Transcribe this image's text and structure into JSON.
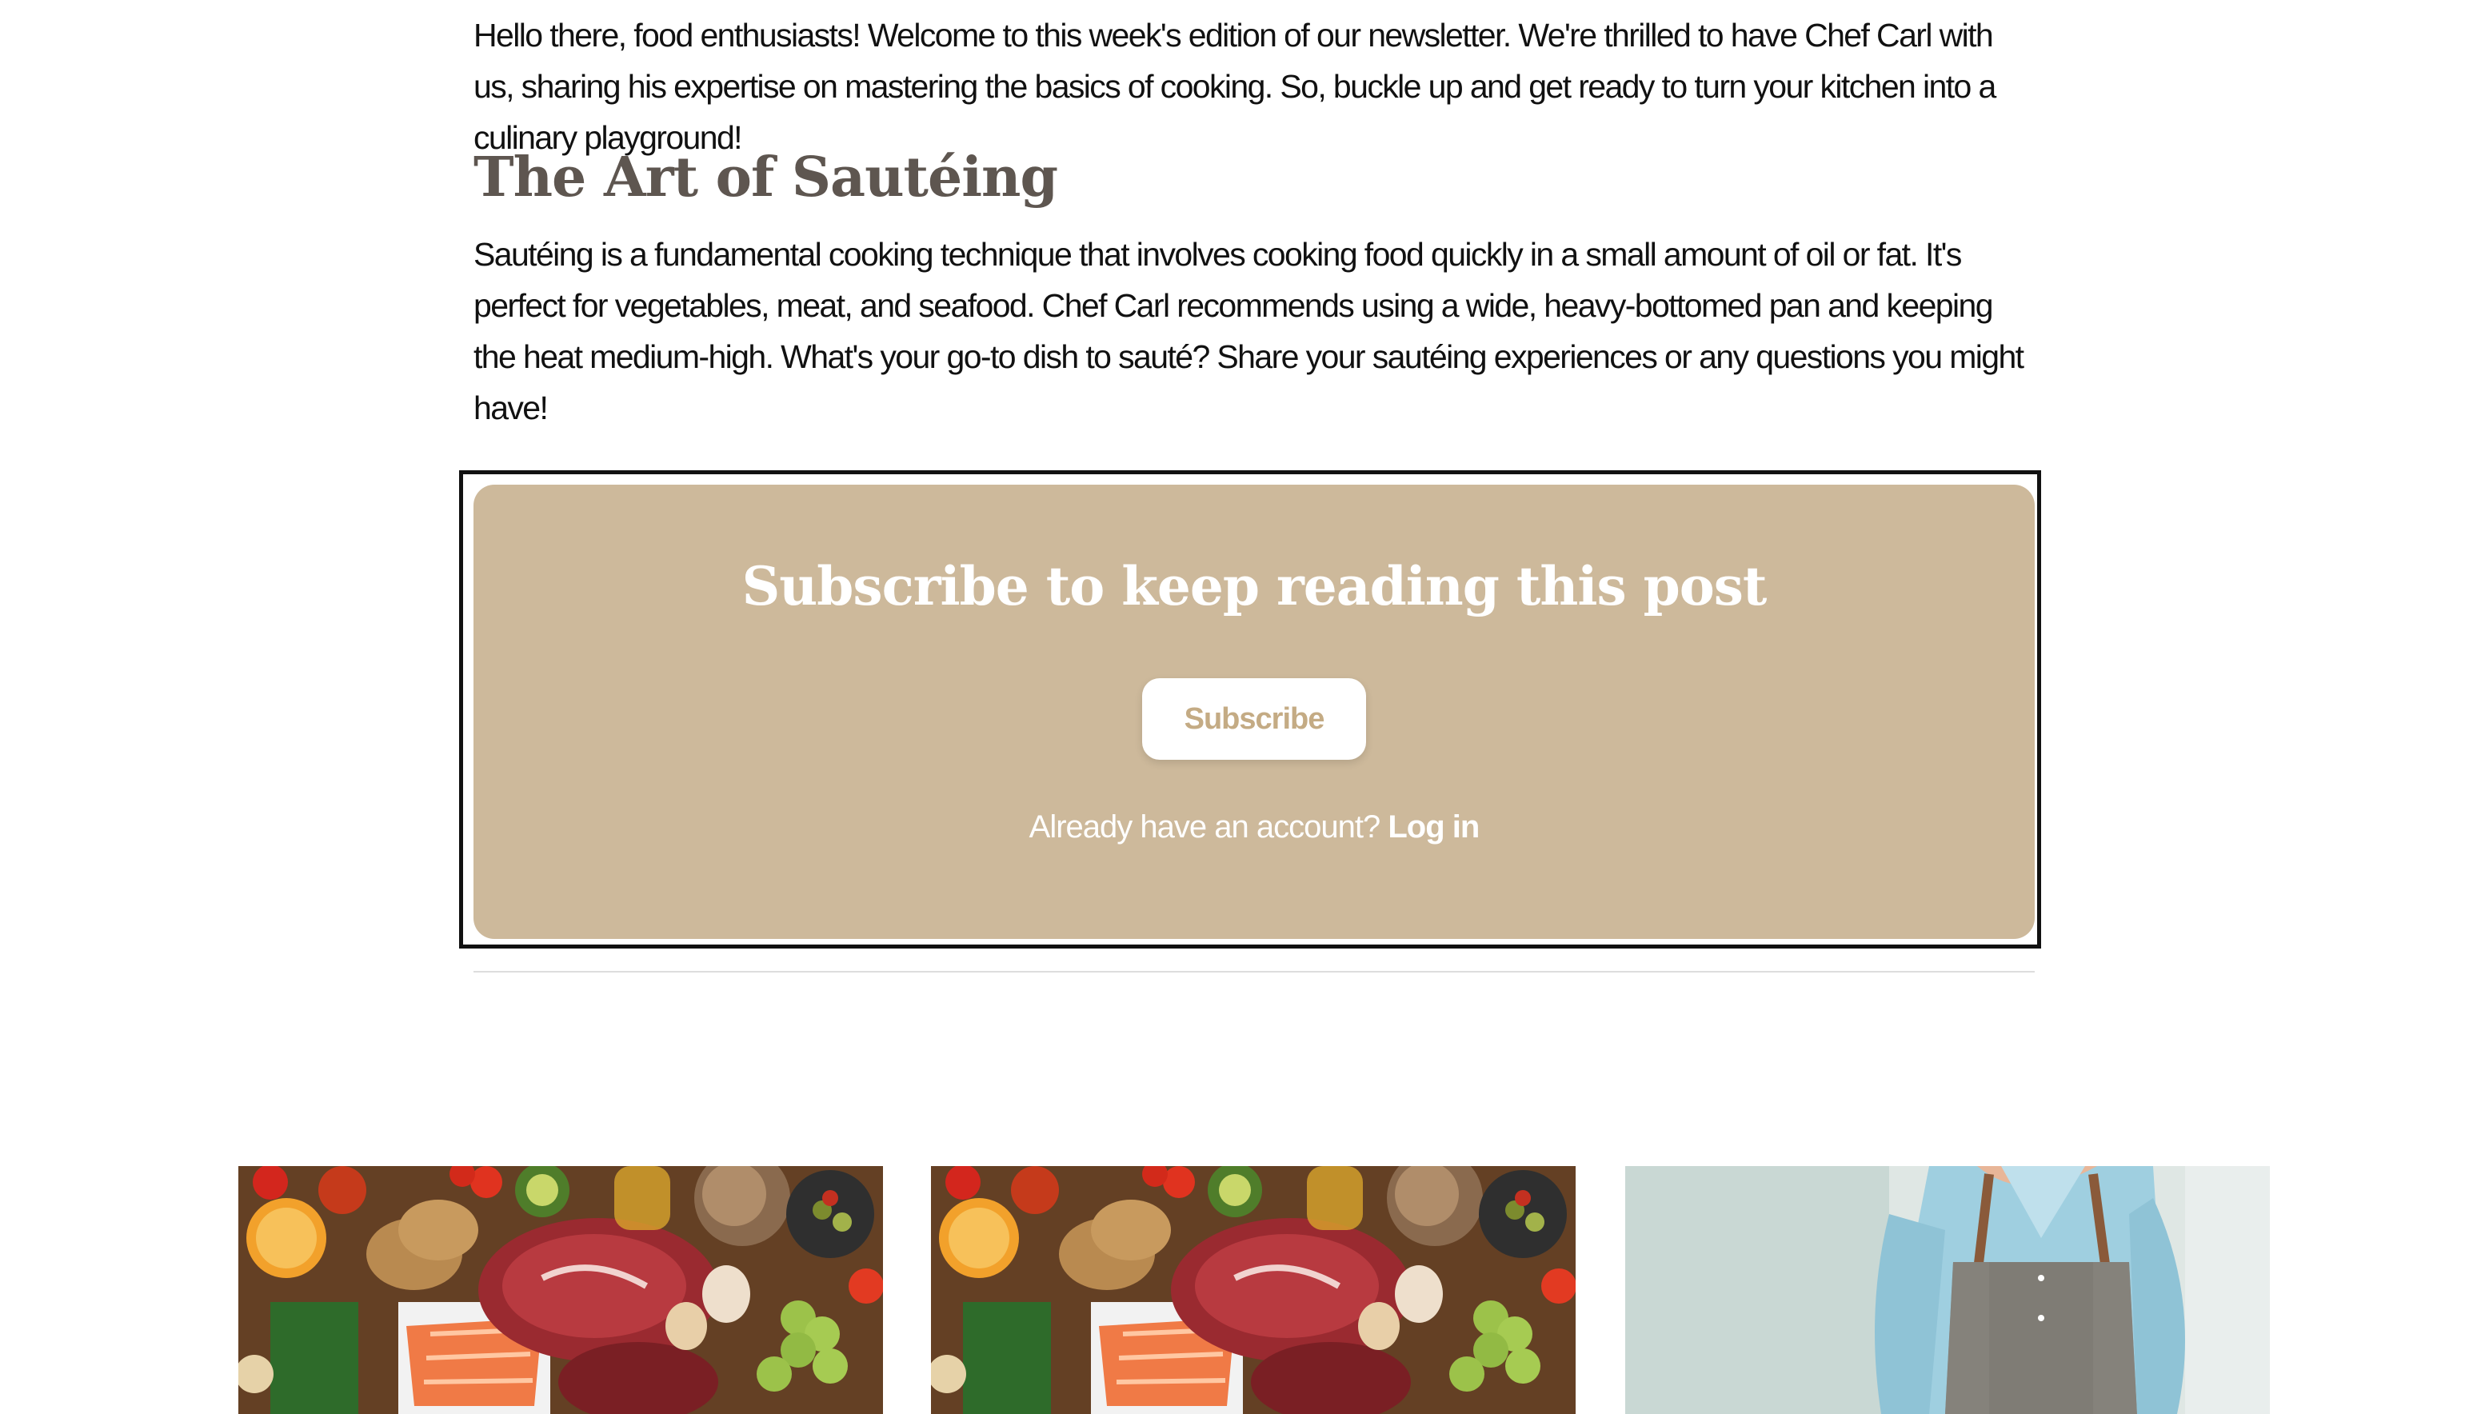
{
  "article": {
    "intro": "Hello there, food enthusiasts! Welcome to this week's edition of our newsletter. We're thrilled to have Chef Carl with us, sharing his expertise on mastering the basics of cooking. So, buckle up and get ready to turn your kitchen into a culinary playground!",
    "heading": "The Art of Sautéing",
    "body": "Sautéing is a fundamental cooking technique that involves cooking food quickly in a small amount of oil or fat. It's perfect for vegetables, meat, and seafood. Chef Carl recommends using a wide, heavy-bottomed pan and keeping the heat medium-high. What's your go-to dish to sauté? Share your sautéing experiences or any questions you might have!"
  },
  "paywall": {
    "title": "Subscribe to keep reading this post",
    "subscribe_label": "Subscribe",
    "account_prompt": "Already have an account?",
    "login_label": "Log in",
    "background_color": "#cdb99b"
  },
  "related": [
    {
      "image": "food-flatlay-image"
    },
    {
      "image": "food-flatlay-image"
    },
    {
      "image": "chef-apron-image"
    }
  ]
}
